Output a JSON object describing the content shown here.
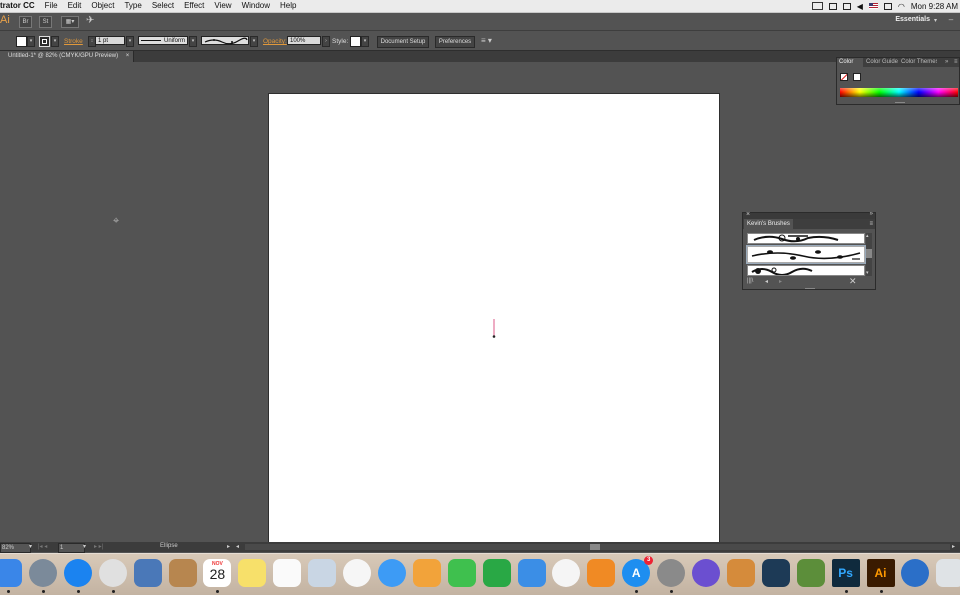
{
  "menubar": {
    "app_name": "trator CC",
    "items": [
      "File",
      "Edit",
      "Object",
      "Type",
      "Select",
      "Effect",
      "View",
      "Window",
      "Help"
    ],
    "clock": "Mon 9:28 AM"
  },
  "appbar": {
    "logo": "Ai",
    "br_label": "Br",
    "st_label": "St",
    "workspace": "Essentials",
    "workspace_caret": "▾"
  },
  "control": {
    "stroke_label": "Stroke",
    "stroke_weight": "1 pt",
    "profile": "Uniform",
    "opacity_label": "Opacity:",
    "opacity_value": "100%",
    "style_label": "Style:",
    "document_setup": "Document Setup",
    "preferences": "Preferences"
  },
  "document": {
    "tab_title": "Untitled-1* @ 82% (CMYK/GPU Preview)",
    "close_glyph": "×"
  },
  "color_panel": {
    "tabs": [
      "Color",
      "Color Guide",
      "Color Themes"
    ],
    "menu_glyph": "≡",
    "expand_glyph": "»"
  },
  "brushes_panel": {
    "title": "Kevin's Brushes",
    "close_glyph": "×",
    "menu_glyph": "≡"
  },
  "status": {
    "zoom": "82%",
    "artboard_number": "1",
    "tool": "Ellipse"
  },
  "dock": {
    "calendar_month": "NOV",
    "calendar_day": "28",
    "appstore_badge": "3",
    "apps": [
      {
        "name": "Finder",
        "icon": "finder-icon",
        "color": "#3a86e8"
      },
      {
        "name": "Launchpad",
        "icon": "rocket-icon",
        "color": "#7b8a9a"
      },
      {
        "name": "Safari",
        "icon": "compass-icon",
        "color": "#1b83f0"
      },
      {
        "name": "Chrome",
        "icon": "chrome-icon",
        "color": "#e0e0e0"
      },
      {
        "name": "Preview",
        "icon": "bird-photo-icon",
        "color": "#4a78b8"
      },
      {
        "name": "Contacts",
        "icon": "contacts-book-icon",
        "color": "#b7864f"
      },
      {
        "name": "Calendar",
        "icon": "calendar-icon",
        "color": "#ffffff"
      },
      {
        "name": "Notes",
        "icon": "notepad-icon",
        "color": "#f7e06a"
      },
      {
        "name": "Reminders",
        "icon": "checklist-icon",
        "color": "#fafafa"
      },
      {
        "name": "Preview Viewer",
        "icon": "photo-viewer-icon",
        "color": "#c9d6e4"
      },
      {
        "name": "Photos",
        "icon": "photos-flower-icon",
        "color": "#f6f6f6"
      },
      {
        "name": "Messages",
        "icon": "speech-bubble-icon",
        "color": "#3d9bf5"
      },
      {
        "name": "Pages",
        "icon": "pen-doc-icon",
        "color": "#f2a33a"
      },
      {
        "name": "FaceTime",
        "icon": "video-camera-icon",
        "color": "#3fc04e"
      },
      {
        "name": "Numbers",
        "icon": "bar-chart-icon",
        "color": "#29a845"
      },
      {
        "name": "Keynote",
        "icon": "podium-icon",
        "color": "#3b8ee6"
      },
      {
        "name": "iTunes",
        "icon": "music-note-icon",
        "color": "#f5f5f5"
      },
      {
        "name": "iBooks",
        "icon": "book-icon",
        "color": "#f08a24"
      },
      {
        "name": "App Store",
        "icon": "app-store-icon",
        "color": "#1e8ef0"
      },
      {
        "name": "System Preferences",
        "icon": "gear-icon",
        "color": "#8a8a8a"
      },
      {
        "name": "Siri",
        "icon": "siri-icon",
        "color": "#6b4fd0"
      },
      {
        "name": "GarageBand",
        "icon": "guitar-icon",
        "color": "#d58b3b"
      },
      {
        "name": "League of Legends",
        "icon": "league-icon",
        "color": "#1d3a56"
      },
      {
        "name": "Minecraft",
        "icon": "grass-block-icon",
        "color": "#5c8e3a"
      },
      {
        "name": "Photoshop",
        "icon": "ps-icon",
        "color": "#0f2a3d"
      },
      {
        "name": "Illustrator",
        "icon": "ai-icon",
        "color": "#3a1b00"
      },
      {
        "name": "QuickTime",
        "icon": "quicktime-icon",
        "color": "#2b6fc8"
      },
      {
        "name": "Trash",
        "icon": "trash-icon",
        "color": "#dfe3e6"
      }
    ]
  },
  "colors": {
    "illustrator_orange": "#e0983b",
    "workspace_gray": "#535353",
    "artboard": "#ffffff"
  }
}
